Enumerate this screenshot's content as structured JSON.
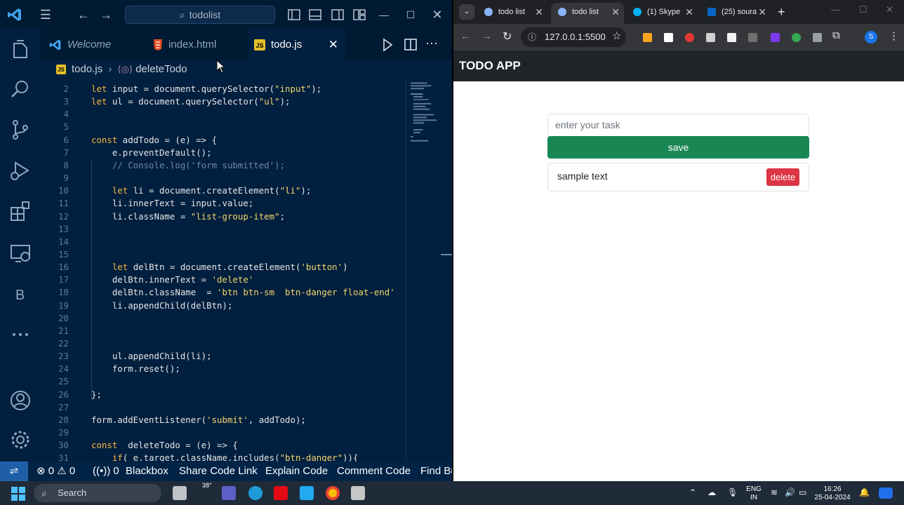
{
  "vscode": {
    "search_text": "todolist",
    "tabs": [
      {
        "label": "Welcome"
      },
      {
        "label": "index.html"
      },
      {
        "label": "todo.js"
      }
    ],
    "breadcrumb": {
      "file": "todo.js",
      "symbol": "deleteTodo"
    },
    "code_lines": [
      {
        "n": "2",
        "text": "let input = document.querySelector(\"input\");"
      },
      {
        "n": "3",
        "text": "let ul = document.querySelector(\"ul\");"
      },
      {
        "n": "4",
        "text": ""
      },
      {
        "n": "5",
        "text": ""
      },
      {
        "n": "6",
        "text": "const addTodo = (e) => {"
      },
      {
        "n": "7",
        "text": "    e.preventDefault();"
      },
      {
        "n": "8",
        "text": "    // Console.log('form submitted');"
      },
      {
        "n": "9",
        "text": ""
      },
      {
        "n": "10",
        "text": "    let li = document.createElement(\"li\");"
      },
      {
        "n": "11",
        "text": "    li.innerText = input.value;"
      },
      {
        "n": "12",
        "text": "    li.className = \"list-group-item\";"
      },
      {
        "n": "13",
        "text": ""
      },
      {
        "n": "14",
        "text": ""
      },
      {
        "n": "15",
        "text": ""
      },
      {
        "n": "16",
        "text": "    let delBtn = document.createElement('button')"
      },
      {
        "n": "17",
        "text": "    delBtn.innerText = 'delete'"
      },
      {
        "n": "18",
        "text": "    delBtn.className  = 'btn btn-sm  btn-danger float-end'"
      },
      {
        "n": "19",
        "text": "    li.appendChild(delBtn);"
      },
      {
        "n": "20",
        "text": ""
      },
      {
        "n": "21",
        "text": ""
      },
      {
        "n": "22",
        "text": ""
      },
      {
        "n": "23",
        "text": "    ul.appendChild(li);"
      },
      {
        "n": "24",
        "text": "    form.reset();"
      },
      {
        "n": "25",
        "text": ""
      },
      {
        "n": "26",
        "text": "};"
      },
      {
        "n": "27",
        "text": ""
      },
      {
        "n": "28",
        "text": "form.addEventListener('submit', addTodo);"
      },
      {
        "n": "29",
        "text": ""
      },
      {
        "n": "30",
        "text": "const  deleteTodo = (e) => {"
      },
      {
        "n": "31",
        "text": "    if( e.target.className.includes(\"btn-danger\")){"
      }
    ],
    "status": {
      "errors": "0",
      "warnings": "0",
      "ports": "0",
      "items": [
        "Blackbox",
        "Share Code Link",
        "Explain Code",
        "Comment Code",
        "Find Bu"
      ]
    },
    "colors": {
      "background": "#011f3e",
      "status_remote": "#1f5fa8"
    }
  },
  "chrome": {
    "tabs": [
      {
        "label": "todo list"
      },
      {
        "label": "todo list"
      },
      {
        "label": "(1) Skype"
      },
      {
        "label": "(25) soura"
      }
    ],
    "new_tab": "+",
    "url": "127.0.0.1:5500",
    "profile_initial": "S"
  },
  "todo_app": {
    "title": "TODO APP",
    "input_placeholder": "enter your task",
    "save_label": "save",
    "items": [
      {
        "text": "sample text",
        "delete_label": "delete"
      }
    ],
    "colors": {
      "navbar": "#212529",
      "save": "#198754",
      "delete": "#dc3545"
    }
  },
  "taskbar": {
    "search_label": "Search",
    "weather": "38°",
    "language": "ENG",
    "region": "IN",
    "time": "16:26",
    "date": "25-04-2024"
  }
}
